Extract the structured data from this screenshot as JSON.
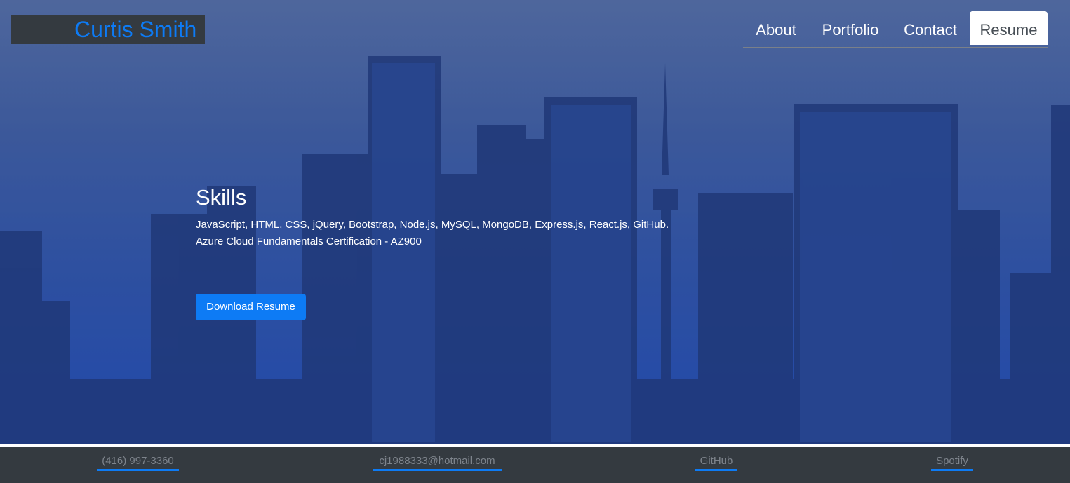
{
  "header": {
    "brand": "Curtis Smith",
    "nav": [
      {
        "label": "About",
        "active": false
      },
      {
        "label": "Portfolio",
        "active": false
      },
      {
        "label": "Contact",
        "active": false
      },
      {
        "label": "Resume",
        "active": true
      }
    ]
  },
  "main": {
    "title": "Skills",
    "lines": [
      "JavaScript, HTML, CSS, jQuery, Bootstrap, Node.js, MySQL, MongoDB, Express.js, React.js, GitHub.",
      "Azure Cloud Fundamentals Certification - AZ900"
    ],
    "download_label": "Download Resume"
  },
  "footer": {
    "links": [
      {
        "label": "(416) 997-3360"
      },
      {
        "label": "cj1988333@hotmail.com"
      },
      {
        "label": "GitHub"
      },
      {
        "label": "Spotify"
      }
    ]
  },
  "colors": {
    "accent": "#0d7bf5",
    "navbar_bg": "#343a40",
    "footer_link": "#7e848c"
  }
}
